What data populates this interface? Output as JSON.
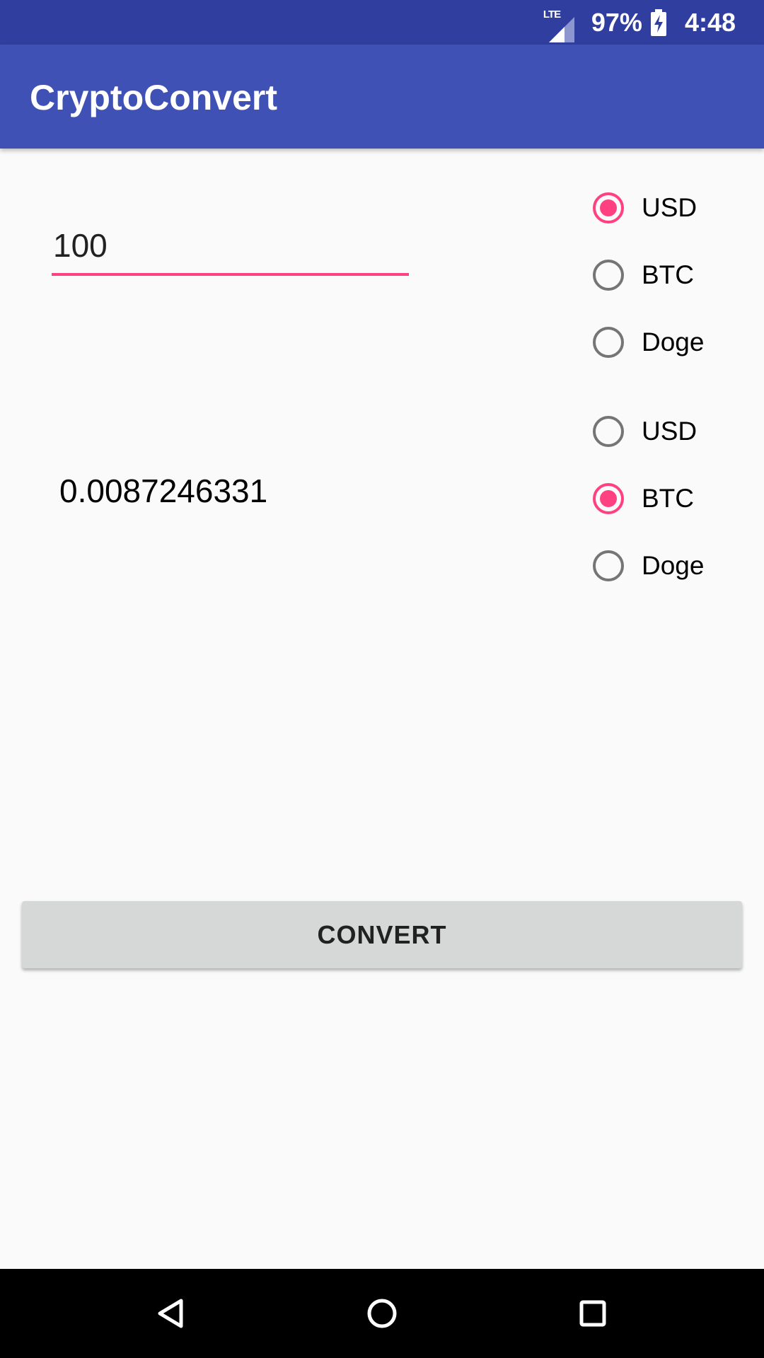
{
  "status_bar": {
    "network": "LTE",
    "battery": "97%",
    "time": "4:48",
    "icons": [
      "lte-signal-icon",
      "battery-charging-icon"
    ]
  },
  "app_bar": {
    "title": "CryptoConvert"
  },
  "amount_input": {
    "value": "100"
  },
  "from_currency": {
    "options": [
      "USD",
      "BTC",
      "Doge"
    ],
    "selected": "USD"
  },
  "to_currency": {
    "options": [
      "USD",
      "BTC",
      "Doge"
    ],
    "selected": "BTC"
  },
  "result": {
    "value": "0.0087246331"
  },
  "convert_button": {
    "label": "CONVERT"
  },
  "nav_bar": {
    "icons": [
      "back-icon",
      "home-icon",
      "recents-icon"
    ]
  },
  "colors": {
    "status_bar": "#303f9f",
    "app_bar": "#3f51b5",
    "accent": "#ff4081",
    "background": "#fafafa",
    "button": "#d6d7d7"
  }
}
